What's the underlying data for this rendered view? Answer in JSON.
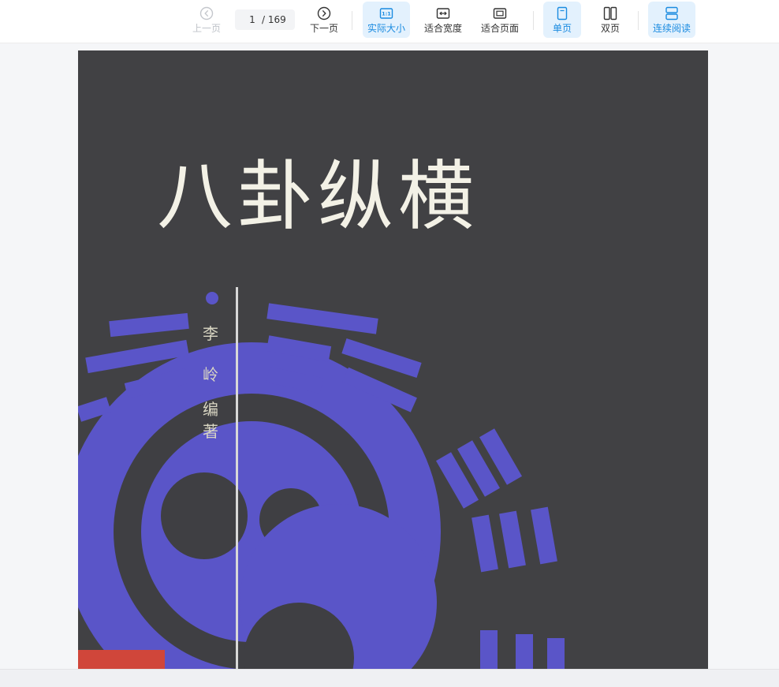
{
  "toolbar": {
    "prev_label": "上一页",
    "page_current": "1",
    "page_total": "/ 169",
    "next_label": "下一页",
    "actual_size_label": "实际大小",
    "fit_width_label": "适合宽度",
    "fit_page_label": "适合页面",
    "single_page_label": "单页",
    "double_page_label": "双页",
    "continuous_label": "连续阅读"
  },
  "cover": {
    "title": "八卦纵横",
    "author_chars": [
      "李",
      "岭",
      "编",
      "著"
    ]
  },
  "colors": {
    "accent": "#1a8be0",
    "active_bg": "#e3f1fd",
    "cover_bg": "#3f3f43",
    "trigram_blue": "#5a55c8",
    "title_text": "#f3f1e6"
  }
}
